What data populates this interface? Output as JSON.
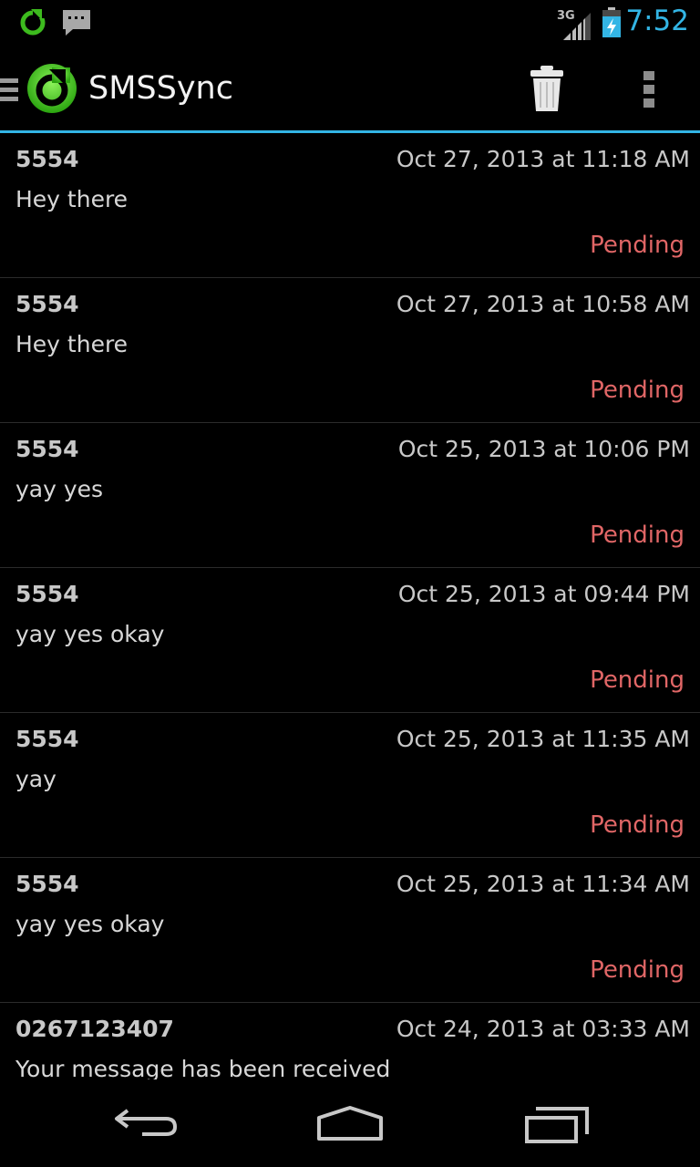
{
  "status_bar": {
    "network_type": "3G",
    "clock": "7:52",
    "icons": [
      "sync-notification-icon",
      "message-notification-icon",
      "signal-icon",
      "battery-charging-icon"
    ]
  },
  "action_bar": {
    "title": "SMSSync",
    "icons": [
      "drawer-indicator-icon",
      "app-logo-icon",
      "trash-icon",
      "overflow-menu-icon"
    ]
  },
  "messages": [
    {
      "from": "5554",
      "date": "Oct 27, 2013 at 11:18 AM",
      "body": "Hey there",
      "status": "Pending"
    },
    {
      "from": "5554",
      "date": "Oct 27, 2013 at 10:58 AM",
      "body": "Hey there",
      "status": "Pending"
    },
    {
      "from": "5554",
      "date": "Oct 25, 2013 at 10:06 PM",
      "body": "yay yes",
      "status": "Pending"
    },
    {
      "from": "5554",
      "date": "Oct 25, 2013 at 09:44 PM",
      "body": "yay yes okay",
      "status": "Pending"
    },
    {
      "from": "5554",
      "date": "Oct 25, 2013 at 11:35 AM",
      "body": "yay",
      "status": "Pending"
    },
    {
      "from": "5554",
      "date": "Oct 25, 2013 at 11:34 AM",
      "body": "yay yes okay",
      "status": "Pending"
    },
    {
      "from": "0267123407",
      "date": "Oct 24, 2013 at 03:33 AM",
      "body": "Your message has been received",
      "status": ""
    }
  ],
  "nav_bar": {
    "icons": [
      "back-icon",
      "home-icon",
      "recents-icon"
    ]
  },
  "colors": {
    "accent": "#33b5e5",
    "pending": "#e06666",
    "logo_green": "#3dbb1e",
    "background": "#000000"
  }
}
